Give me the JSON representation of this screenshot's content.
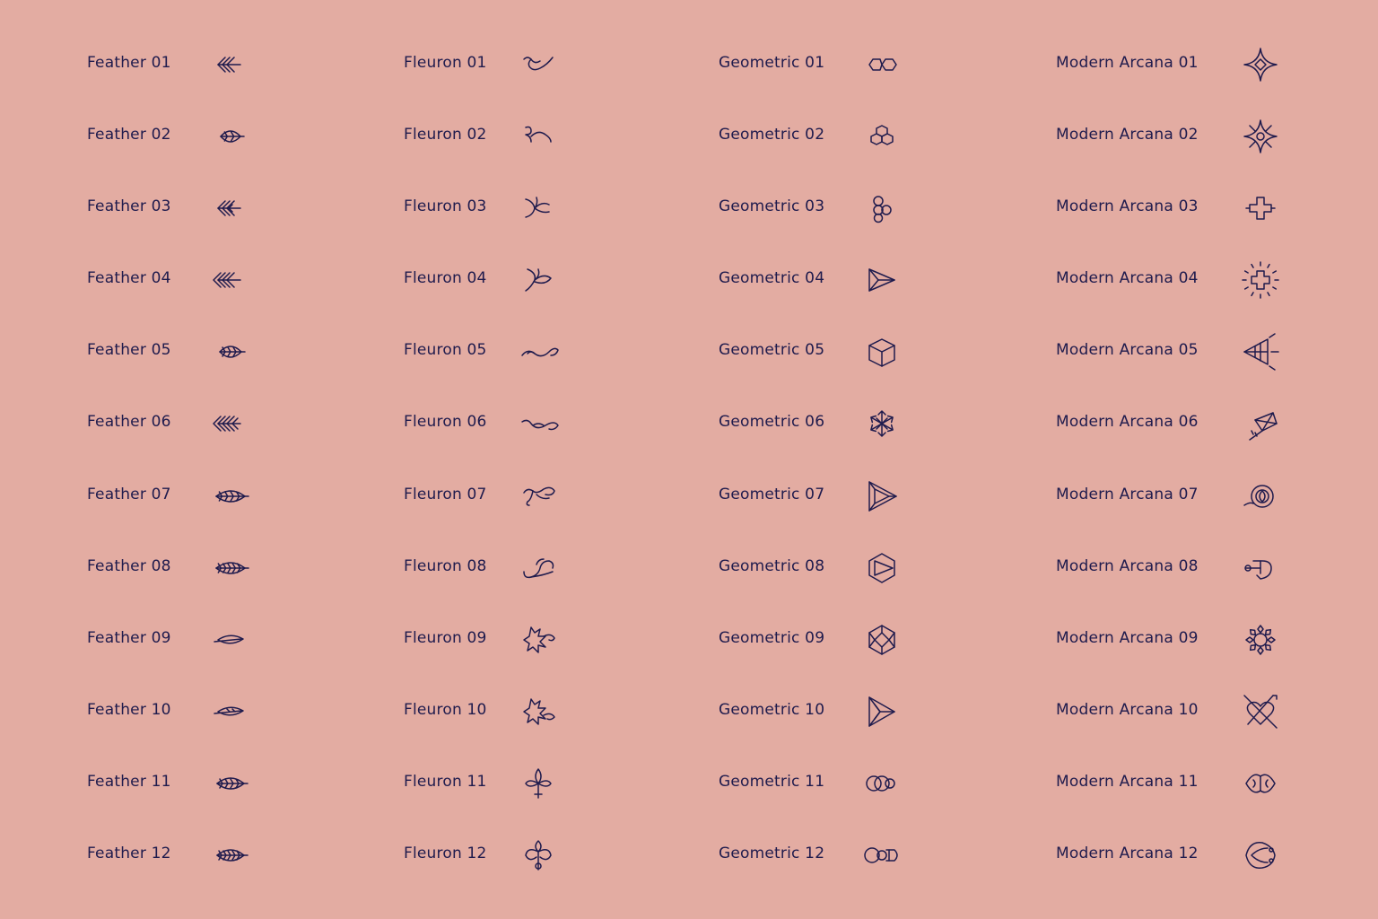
{
  "columns": [
    {
      "key": "feather",
      "items": [
        {
          "label": "Feather 01",
          "icon": "feather-01-icon"
        },
        {
          "label": "Feather 02",
          "icon": "feather-02-icon"
        },
        {
          "label": "Feather 03",
          "icon": "feather-03-icon"
        },
        {
          "label": "Feather 04",
          "icon": "feather-04-icon"
        },
        {
          "label": "Feather 05",
          "icon": "feather-05-icon"
        },
        {
          "label": "Feather 06",
          "icon": "feather-06-icon"
        },
        {
          "label": "Feather 07",
          "icon": "feather-07-icon"
        },
        {
          "label": "Feather 08",
          "icon": "feather-08-icon"
        },
        {
          "label": "Feather 09",
          "icon": "feather-09-icon"
        },
        {
          "label": "Feather 10",
          "icon": "feather-10-icon"
        },
        {
          "label": "Feather 11",
          "icon": "feather-11-icon"
        },
        {
          "label": "Feather 12",
          "icon": "feather-12-icon"
        }
      ]
    },
    {
      "key": "fleuron",
      "items": [
        {
          "label": "Fleuron 01",
          "icon": "fleuron-01-icon"
        },
        {
          "label": "Fleuron 02",
          "icon": "fleuron-02-icon"
        },
        {
          "label": "Fleuron 03",
          "icon": "fleuron-03-icon"
        },
        {
          "label": "Fleuron 04",
          "icon": "fleuron-04-icon"
        },
        {
          "label": "Fleuron 05",
          "icon": "fleuron-05-icon"
        },
        {
          "label": "Fleuron 06",
          "icon": "fleuron-06-icon"
        },
        {
          "label": "Fleuron 07",
          "icon": "fleuron-07-icon"
        },
        {
          "label": "Fleuron 08",
          "icon": "fleuron-08-icon"
        },
        {
          "label": "Fleuron 09",
          "icon": "fleuron-09-icon"
        },
        {
          "label": "Fleuron 10",
          "icon": "fleuron-10-icon"
        },
        {
          "label": "Fleuron 11",
          "icon": "fleuron-11-icon"
        },
        {
          "label": "Fleuron 12",
          "icon": "fleuron-12-icon"
        }
      ]
    },
    {
      "key": "geometric",
      "items": [
        {
          "label": "Geometric 01",
          "icon": "geometric-01-icon"
        },
        {
          "label": "Geometric 02",
          "icon": "geometric-02-icon"
        },
        {
          "label": "Geometric 03",
          "icon": "geometric-03-icon"
        },
        {
          "label": "Geometric 04",
          "icon": "geometric-04-icon"
        },
        {
          "label": "Geometric 05",
          "icon": "geometric-05-icon"
        },
        {
          "label": "Geometric 06",
          "icon": "geometric-06-icon"
        },
        {
          "label": "Geometric 07",
          "icon": "geometric-07-icon"
        },
        {
          "label": "Geometric 08",
          "icon": "geometric-08-icon"
        },
        {
          "label": "Geometric 09",
          "icon": "geometric-09-icon"
        },
        {
          "label": "Geometric 10",
          "icon": "geometric-10-icon"
        },
        {
          "label": "Geometric 11",
          "icon": "geometric-11-icon"
        },
        {
          "label": "Geometric 12",
          "icon": "geometric-12-icon"
        }
      ]
    },
    {
      "key": "modern-arcana",
      "items": [
        {
          "label": "Modern Arcana 01",
          "icon": "modern-arcana-01-icon"
        },
        {
          "label": "Modern Arcana 02",
          "icon": "modern-arcana-02-icon"
        },
        {
          "label": "Modern Arcana 03",
          "icon": "modern-arcana-03-icon"
        },
        {
          "label": "Modern Arcana 04",
          "icon": "modern-arcana-04-icon"
        },
        {
          "label": "Modern Arcana 05",
          "icon": "modern-arcana-05-icon"
        },
        {
          "label": "Modern Arcana 06",
          "icon": "modern-arcana-06-icon"
        },
        {
          "label": "Modern Arcana 07",
          "icon": "modern-arcana-07-icon"
        },
        {
          "label": "Modern Arcana 08",
          "icon": "modern-arcana-08-icon"
        },
        {
          "label": "Modern Arcana 09",
          "icon": "modern-arcana-09-icon"
        },
        {
          "label": "Modern Arcana 10",
          "icon": "modern-arcana-10-icon"
        },
        {
          "label": "Modern Arcana 11",
          "icon": "modern-arcana-11-icon"
        },
        {
          "label": "Modern Arcana 12",
          "icon": "modern-arcana-12-icon"
        }
      ]
    }
  ],
  "colors": {
    "background": "#e3aca2",
    "ink": "#1f1b4d"
  }
}
